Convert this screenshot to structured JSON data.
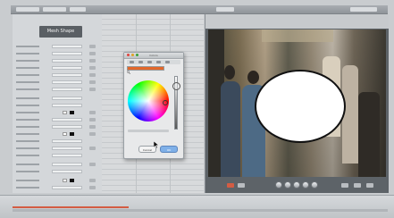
{
  "inspector": {
    "header_label": "Mesh Shape"
  },
  "colors_window": {
    "title": "Colors",
    "current_color": "#e2672a",
    "selected_hue_icon": "color-wheel-icon",
    "cancel_label": "Cancel",
    "ok_label": "OK"
  },
  "canvas": {
    "overlay_shape": "ellipse",
    "overlay_fill": "#ffffff"
  },
  "colors": {
    "accent_red": "#d35c43",
    "ok_blue": "#7fb0e8"
  }
}
